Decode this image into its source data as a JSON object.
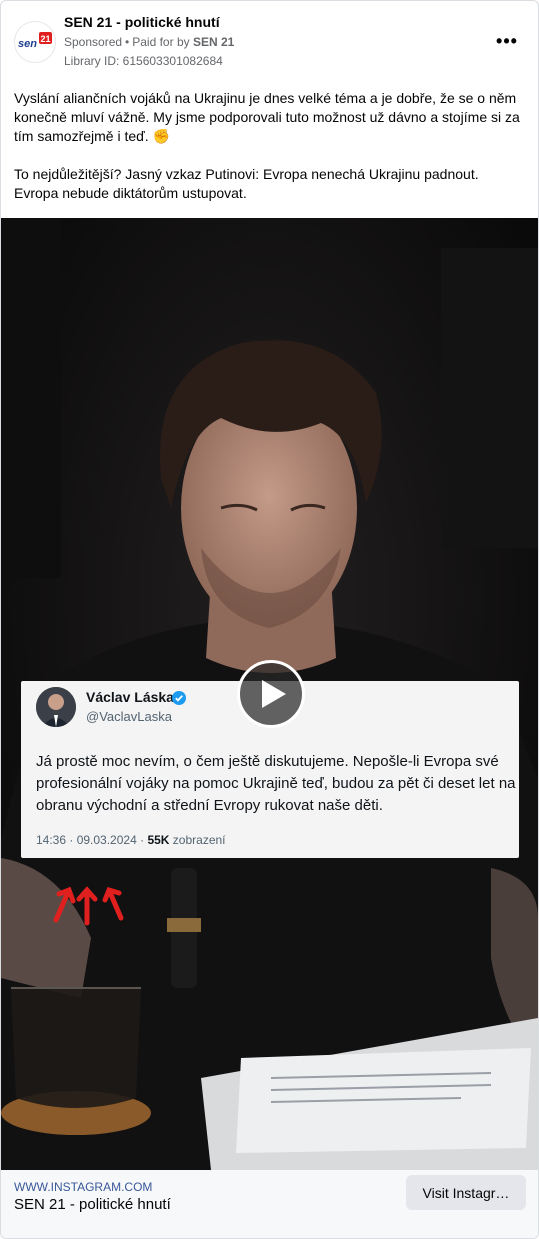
{
  "post": {
    "page_name": "SEN 21 - politické hnutí",
    "avatar_logo_text": "sen21",
    "sponsored": "Sponsored",
    "paid_for_prefix": "Paid for by",
    "paid_for_by": "SEN 21",
    "library_id": "Library ID: 615603301082684",
    "more_icon": "more-options-icon",
    "paragraphs": [
      "Vyslání aliančních vojáků na Ukrajinu je dnes velké téma a je dobře, že se o něm konečně mluví vážně. My jsme podporovali tuto možnost už dávno a stojíme si za tím samozřejmě i teď. ✊",
      "To nejdůležitější? Jasný vzkaz Putinovi: Evropa nenechá Ukrajinu padnout. Evropa nebude diktátorům ustupovat."
    ]
  },
  "media": {
    "type": "video",
    "play_icon": "play-icon",
    "tweet": {
      "name": "Václav Láska",
      "handle": "@VaclavLaska",
      "text": "Já prostě moc nevím, o čem ještě diskutujeme. Nepošle-li Evropa své profesionální vojáky na pomoc Ukrajině teď, budou za pět či deset let na obranu východní a střední Evropy rukovat naše děti.",
      "time": "14:36 · 09.03.2024 ·",
      "views": "55K",
      "views_label": "zobrazení"
    }
  },
  "footer": {
    "domain": "WWW.INSTAGRAM.COM",
    "title": "SEN 21 - politické hnutí",
    "cta": "Visit Instagr…"
  },
  "colors": {
    "link_blue": "#385898",
    "verified_blue": "#1d9bf0",
    "arrow_red": "#e0201e"
  }
}
